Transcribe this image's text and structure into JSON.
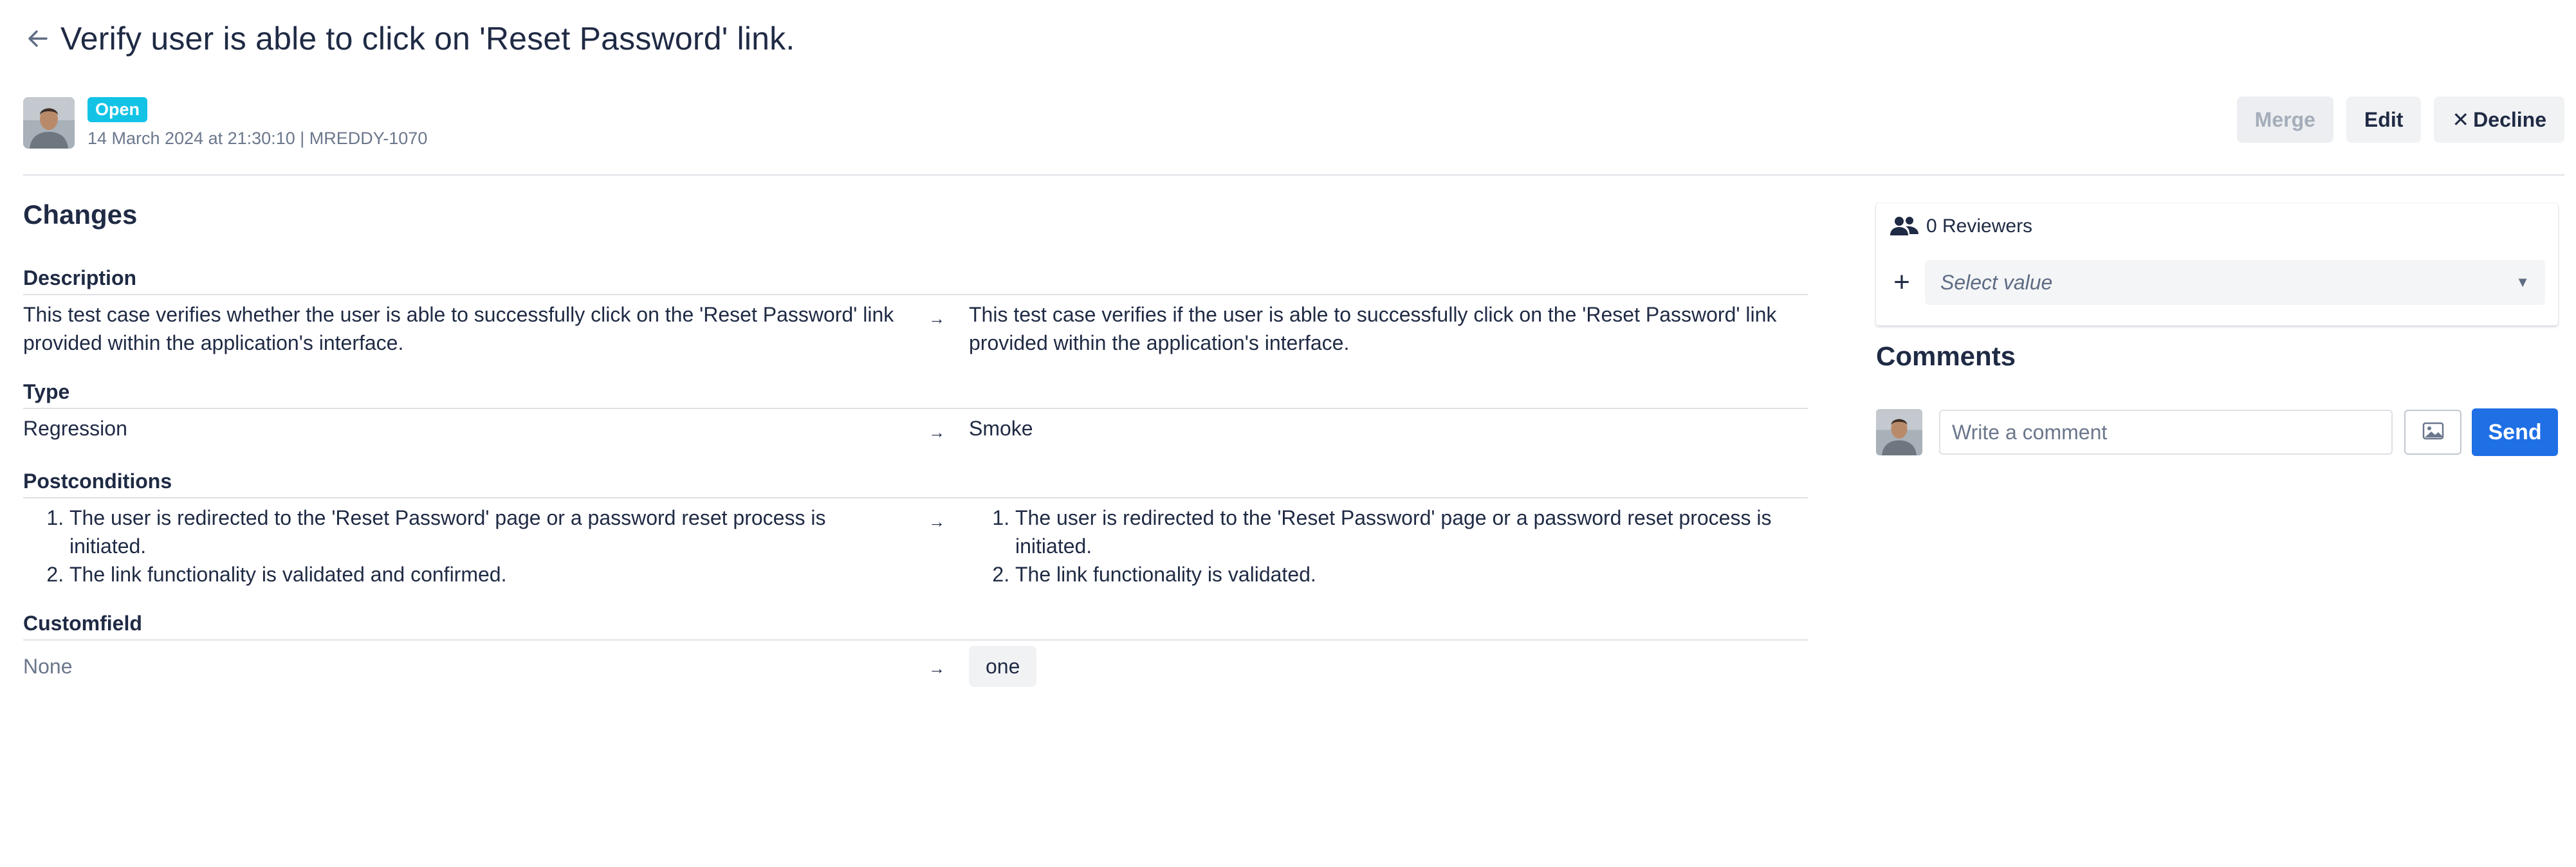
{
  "header": {
    "title": "Verify user is able to click on 'Reset Password' link.",
    "status_badge": "Open",
    "meta": "14 March 2024 at 21:30:10 | MREDDY-1070"
  },
  "actions": {
    "merge_label": "Merge",
    "edit_label": "Edit",
    "decline_label": "Decline"
  },
  "changes": {
    "title": "Changes",
    "description": {
      "label": "Description",
      "old": "This test case verifies whether the user is able to successfully click on the 'Reset Password' link provided within the application's interface.",
      "new": "This test case verifies if the user is able to successfully click on the 'Reset Password' link provided within the application's interface."
    },
    "type": {
      "label": "Type",
      "old": "Regression",
      "new": "Smoke"
    },
    "postconditions": {
      "label": "Postconditions",
      "old": [
        "The user is redirected to the 'Reset Password' page or a password reset process is initiated.",
        "The link functionality is validated and confirmed."
      ],
      "new": [
        "The user is redirected to the 'Reset Password' page or a password reset process is initiated.",
        "The link functionality is validated."
      ]
    },
    "customfield": {
      "label": "Customfield",
      "old": "None",
      "new": "one"
    },
    "arrow_glyph": "→"
  },
  "reviewers": {
    "count_label": "0 Reviewers",
    "plus_glyph": "+",
    "select_placeholder": "Select value"
  },
  "comments": {
    "title": "Comments",
    "input_placeholder": "Write a comment",
    "send_label": "Send"
  },
  "colors": {
    "badge": "#12c3e6",
    "primary": "#1f6fe5",
    "text": "#1f2a44",
    "muted": "#6b778c"
  },
  "icons": [
    "back-arrow-icon",
    "users-icon",
    "plus-icon",
    "chevron-down-icon",
    "image-icon",
    "close-icon"
  ]
}
